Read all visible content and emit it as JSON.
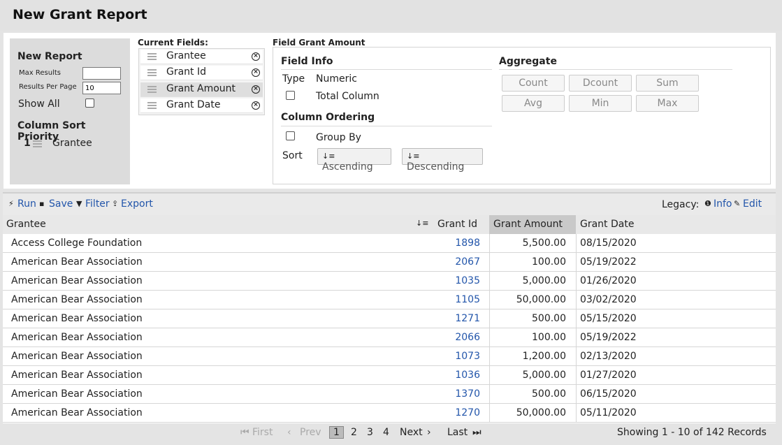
{
  "title": "New Grant Report",
  "left_panel": {
    "heading": "New Report",
    "max_results_label": "Max Results",
    "max_results_value": "",
    "results_per_page_label": "Results Per Page",
    "results_per_page_value": "10",
    "show_all_label": "Show All",
    "sort_heading": "Column Sort Priority",
    "sort_items": [
      {
        "num": "1",
        "name": "Grantee"
      }
    ]
  },
  "current_fields": {
    "heading": "Current Fields:",
    "items": [
      "Grantee",
      "Grant Id",
      "Grant Amount",
      "Grant Date"
    ],
    "active_index": 2
  },
  "field_panel": {
    "heading": "Field Grant Amount",
    "info_heading": "Field Info",
    "type_label": "Type",
    "type_value": "Numeric",
    "total_column_label": "Total Column",
    "ordering_heading": "Column Ordering",
    "group_by_label": "Group By",
    "sort_label": "Sort",
    "ascending_label": "Ascending",
    "descending_label": "Descending",
    "aggregate_heading": "Aggregate",
    "aggregate_buttons": [
      "Count",
      "Dcount",
      "Sum",
      "Avg",
      "Min",
      "Max"
    ]
  },
  "toolbar": {
    "run": "Run",
    "save": "Save",
    "filter": "Filter",
    "export": "Export",
    "legacy_label": "Legacy:",
    "info": "Info",
    "edit": "Edit"
  },
  "table": {
    "columns": [
      "Grantee",
      "Grant Id",
      "Grant Amount",
      "Grant Date"
    ],
    "active_column": "Grant Amount",
    "rows": [
      [
        "Access College Foundation",
        "1898",
        "5,500.00",
        "08/15/2020"
      ],
      [
        "American Bear Association",
        "2067",
        "100.00",
        "05/19/2022"
      ],
      [
        "American Bear Association",
        "1035",
        "5,000.00",
        "01/26/2020"
      ],
      [
        "American Bear Association",
        "1105",
        "50,000.00",
        "03/02/2020"
      ],
      [
        "American Bear Association",
        "1271",
        "500.00",
        "05/15/2020"
      ],
      [
        "American Bear Association",
        "2066",
        "100.00",
        "05/19/2022"
      ],
      [
        "American Bear Association",
        "1073",
        "1,200.00",
        "02/13/2020"
      ],
      [
        "American Bear Association",
        "1036",
        "5,000.00",
        "01/27/2020"
      ],
      [
        "American Bear Association",
        "1370",
        "500.00",
        "06/15/2020"
      ],
      [
        "American Bear Association",
        "1270",
        "50,000.00",
        "05/11/2020"
      ]
    ]
  },
  "pager": {
    "first": "First",
    "prev": "Prev",
    "pages": [
      "1",
      "2",
      "3",
      "4"
    ],
    "current": "1",
    "next": "Next",
    "last": "Last",
    "summary": "Showing 1 - 10 of 142 Records"
  }
}
